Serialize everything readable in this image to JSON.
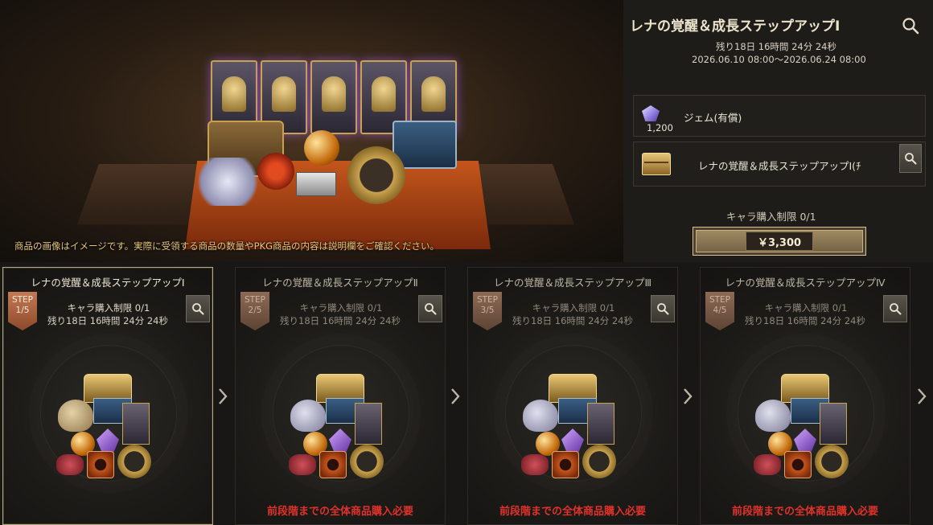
{
  "banner": {
    "disclaimer": "商品の画像はイメージです。実際に受領する商品の数量やPKG商品の内容は説明欄をご確認ください。"
  },
  "package": {
    "title": "レナの覚醒＆成長ステップアップⅠ",
    "remaining": "残り18日 16時間 24分 24秒",
    "period": "2026.06.10 08:00～2026.06.24 08:00",
    "items": [
      {
        "icon": "gem-icon",
        "name": "ジェム(有償)",
        "count": "1,200"
      },
      {
        "icon": "treasure-chest-icon",
        "name": "レナの覚醒＆成長ステップアップⅠ(ﾁ"
      }
    ],
    "purchase_limit": "キャラ購入制限 0/1",
    "price": "￥3,300"
  },
  "steps": [
    {
      "title": "レナの覚醒＆成長ステップアップⅠ",
      "badge_label": "STEP",
      "badge_num": "1/5",
      "limit": "キャラ購入制限 0/1",
      "remaining": "残り18日 16時間 24分 24秒",
      "footer": ""
    },
    {
      "title": "レナの覚醒＆成長ステップアップⅡ",
      "badge_label": "STEP",
      "badge_num": "2/5",
      "limit": "キャラ購入制限 0/1",
      "remaining": "残り18日 16時間 24分 24秒",
      "footer": "前段階までの全体商品購入必要"
    },
    {
      "title": "レナの覚醒＆成長ステップアップⅢ",
      "badge_label": "STEP",
      "badge_num": "3/5",
      "limit": "キャラ購入制限 0/1",
      "remaining": "残り18日 16時間 24分 24秒",
      "footer": "前段階までの全体商品購入必要"
    },
    {
      "title": "レナの覚醒＆成長ステップアップⅣ",
      "badge_label": "STEP",
      "badge_num": "4/5",
      "limit": "キャラ購入制限 0/1",
      "remaining": "残り18日 16時間 24分 24秒",
      "footer": "前段階までの全体商品購入必要"
    }
  ],
  "colors": {
    "accent_gold": "#c9a24e",
    "locked_warning": "#e0322a",
    "badge": "#b06642"
  }
}
